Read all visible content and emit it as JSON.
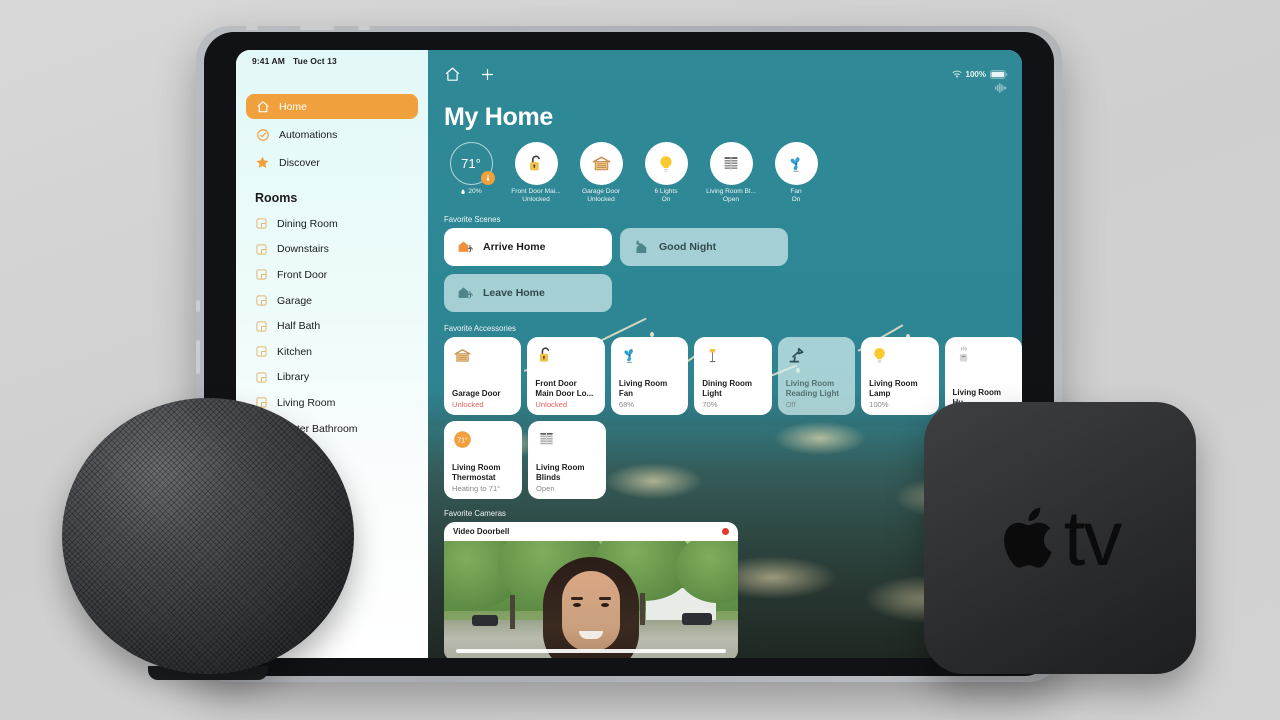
{
  "device": {
    "homepod_name": "homepod-mini",
    "appletv_label": "tv"
  },
  "statusbar": {
    "time": "9:41 AM",
    "date": "Tue Oct 13",
    "battery": "100%",
    "wifi_icon": "wifi-icon",
    "battery_icon": "battery-icon",
    "siri_icon": "siri-waveform-icon"
  },
  "sidebar": {
    "nav": [
      {
        "label": "Home",
        "icon": "home-icon",
        "active": true
      },
      {
        "label": "Automations",
        "icon": "automation-clock-icon",
        "active": false
      },
      {
        "label": "Discover",
        "icon": "star-icon",
        "active": false
      }
    ],
    "rooms_header": "Rooms",
    "rooms": [
      {
        "label": "Dining Room",
        "icon": "room-icon"
      },
      {
        "label": "Downstairs",
        "icon": "room-icon"
      },
      {
        "label": "Front Door",
        "icon": "room-icon"
      },
      {
        "label": "Garage",
        "icon": "room-icon"
      },
      {
        "label": "Half Bath",
        "icon": "room-icon"
      },
      {
        "label": "Kitchen",
        "icon": "room-icon"
      },
      {
        "label": "Library",
        "icon": "room-icon"
      },
      {
        "label": "Living Room",
        "icon": "room-icon"
      },
      {
        "label": "Master Bathroom",
        "icon": "room-icon"
      }
    ]
  },
  "toolbar": {
    "home_icon": "home-outline-icon",
    "add_icon": "plus-icon"
  },
  "main": {
    "title": "My Home",
    "status_pills": [
      {
        "type": "temperature",
        "value": "71°",
        "sub": "20%",
        "icon": "humidity-drop-icon",
        "badge_icon": "thermostat-badge-icon"
      },
      {
        "type": "accessory",
        "name": "Front Door Mai...",
        "state": "Unlocked",
        "icon": "lock-open-icon"
      },
      {
        "type": "accessory",
        "name": "Garage Door",
        "state": "Unlocked",
        "icon": "garage-icon"
      },
      {
        "type": "accessory",
        "name": "6 Lights",
        "state": "On",
        "icon": "lightbulb-icon"
      },
      {
        "type": "accessory",
        "name": "Living Room Bl...",
        "state": "Open",
        "icon": "blinds-icon"
      },
      {
        "type": "accessory",
        "name": "Fan",
        "state": "On",
        "icon": "fan-icon"
      }
    ],
    "scenes_header": "Favorite Scenes",
    "scenes": [
      {
        "label": "Arrive Home",
        "icon": "house-arrive-icon",
        "active": true
      },
      {
        "label": "Good Night",
        "icon": "house-moon-icon",
        "active": false
      },
      {
        "label": "Leave Home",
        "icon": "house-leave-icon",
        "active": false
      }
    ],
    "accessories_header": "Favorite Accessories",
    "accessories_row1": [
      {
        "name": "Garage Door",
        "state": "Unlocked",
        "icon": "garage-icon",
        "alert": true,
        "off": false
      },
      {
        "name": "Front Door Main Door Lo...",
        "state": "Unlocked",
        "icon": "lock-open-icon",
        "alert": true,
        "off": false
      },
      {
        "name": "Living Room Fan",
        "state": "68%",
        "icon": "fan-icon",
        "alert": false,
        "off": false
      },
      {
        "name": "Dining Room Light",
        "state": "70%",
        "icon": "floor-lamp-icon",
        "alert": false,
        "off": false
      },
      {
        "name": "Living Room Reading Light",
        "state": "Off",
        "icon": "desk-lamp-icon",
        "alert": false,
        "off": true
      },
      {
        "name": "Living Room Lamp",
        "state": "100%",
        "icon": "lightbulb-icon",
        "alert": false,
        "off": false
      },
      {
        "name": "Living Room Hu...",
        "state": "",
        "icon": "humidifier-icon",
        "alert": false,
        "off": false
      }
    ],
    "accessories_row2": [
      {
        "name": "Living Room Thermostat",
        "state": "Heating to 71°",
        "icon": "thermostat-badge-icon",
        "alert": false,
        "off": false
      },
      {
        "name": "Living Room Blinds",
        "state": "Open",
        "icon": "blinds-icon",
        "alert": false,
        "off": false
      }
    ],
    "cameras_header": "Favorite Cameras",
    "camera": {
      "name": "Video Doorbell",
      "recording_icon": "record-dot-icon"
    }
  },
  "colors": {
    "accent_orange": "#f0a03c",
    "wallpaper_teal": "#2e8896",
    "alert_red": "#e2645c",
    "record_red": "#e8392b"
  }
}
